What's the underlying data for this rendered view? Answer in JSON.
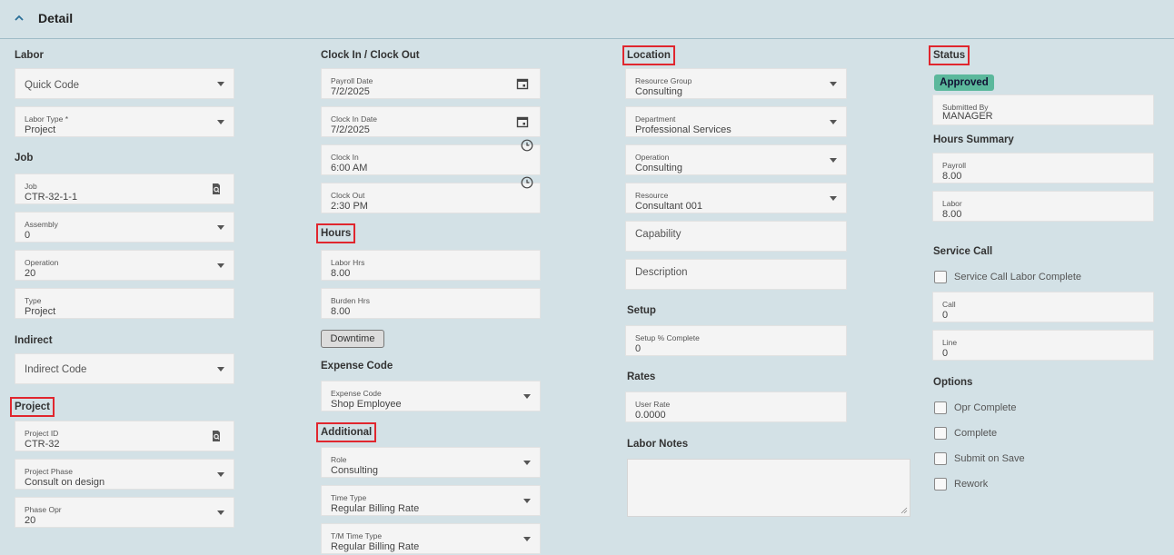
{
  "header": {
    "title": "Detail",
    "collapse_icon": "chevron-up-icon"
  },
  "col1": {
    "labor": {
      "title": "Labor",
      "quick_code": {
        "placeholder": "Quick Code"
      },
      "labor_type": {
        "label": "Labor Type *",
        "value": "Project"
      }
    },
    "job": {
      "title": "Job",
      "job": {
        "label": "Job",
        "value": "CTR-32-1-1"
      },
      "assembly": {
        "label": "Assembly",
        "value": "0"
      },
      "operation": {
        "label": "Operation",
        "value": "20"
      },
      "type": {
        "label": "Type",
        "value": "Project"
      }
    },
    "indirect": {
      "title": "Indirect",
      "indirect_code": {
        "placeholder": "Indirect Code"
      }
    },
    "project": {
      "title": "Project",
      "project_id": {
        "label": "Project ID",
        "value": "CTR-32"
      },
      "project_phase": {
        "label": "Project Phase",
        "value": "Consult on design"
      },
      "phase_opr": {
        "label": "Phase Opr",
        "value": "20"
      }
    }
  },
  "col2": {
    "clock": {
      "title": "Clock In / Clock Out",
      "payroll_date": {
        "label": "Payroll Date",
        "value": "7/2/2025"
      },
      "clock_in_date": {
        "label": "Clock In Date",
        "value": "7/2/2025"
      },
      "clock_in": {
        "label": "Clock In",
        "value": "6:00 AM"
      },
      "clock_out": {
        "label": "Clock Out",
        "value": "2:30 PM"
      }
    },
    "hours": {
      "title": "Hours",
      "labor_hrs": {
        "label": "Labor Hrs",
        "value": "8.00"
      },
      "burden_hrs": {
        "label": "Burden Hrs",
        "value": "8.00"
      },
      "downtime_label": "Downtime"
    },
    "expense": {
      "title": "Expense Code",
      "expense_code": {
        "label": "Expense Code",
        "value": "Shop Employee"
      }
    },
    "additional": {
      "title": "Additional",
      "role": {
        "label": "Role",
        "value": "Consulting"
      },
      "time_type": {
        "label": "Time Type",
        "value": "Regular Billing Rate"
      },
      "tm_time_type": {
        "label": "T/M Time Type",
        "value": "Regular Billing Rate"
      }
    }
  },
  "col3": {
    "location": {
      "title": "Location",
      "resource_group": {
        "label": "Resource Group",
        "value": "Consulting"
      },
      "department": {
        "label": "Department",
        "value": "Professional Services"
      },
      "operation": {
        "label": "Operation",
        "value": "Consulting"
      },
      "resource": {
        "label": "Resource",
        "value": "Consultant 001"
      },
      "capability": {
        "placeholder": "Capability"
      },
      "description": {
        "placeholder": "Description"
      }
    },
    "setup": {
      "title": "Setup",
      "setup_pct": {
        "label": "Setup % Complete",
        "value": "0"
      }
    },
    "rates": {
      "title": "Rates",
      "user_rate": {
        "label": "User Rate",
        "value": "0.0000"
      }
    },
    "labor_notes": {
      "title": "Labor Notes"
    }
  },
  "col4": {
    "status": {
      "title": "Status",
      "badge": "Approved",
      "submitted_by": {
        "label": "Submitted By",
        "value": "MANAGER"
      }
    },
    "hours_summary": {
      "title": "Hours Summary",
      "payroll": {
        "label": "Payroll",
        "value": "8.00"
      },
      "labor": {
        "label": "Labor",
        "value": "8.00"
      }
    },
    "service_call": {
      "title": "Service Call",
      "labor_complete": "Service Call Labor Complete",
      "call": {
        "label": "Call",
        "value": "0"
      },
      "line": {
        "label": "Line",
        "value": "0"
      }
    },
    "options": {
      "title": "Options",
      "items": [
        "Opr Complete",
        "Complete",
        "Submit on Save",
        "Rework"
      ]
    }
  },
  "colors": {
    "accent_badge": "#5bb89c",
    "highlight_box": "#e0262e",
    "background": "#d3e1e6"
  }
}
